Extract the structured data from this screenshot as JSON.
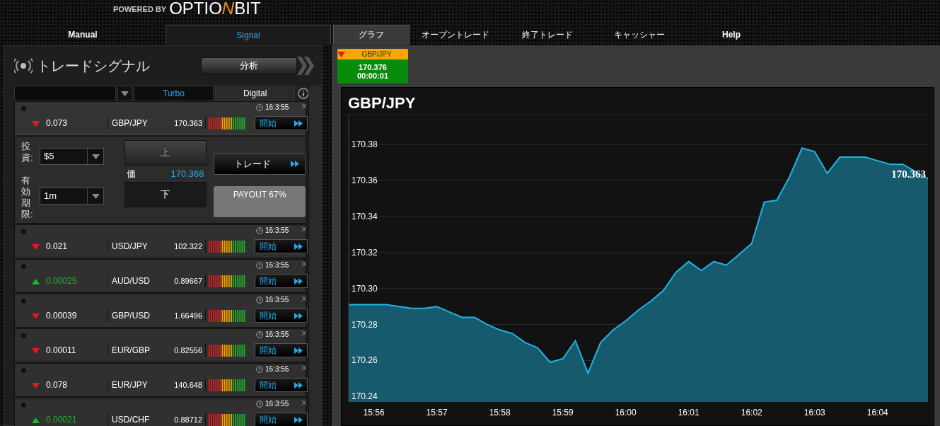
{
  "header": {
    "tagline": "POWERED BY",
    "logo": [
      {
        "text": "OPTIO",
        "accent": false
      },
      {
        "text": "N",
        "accent": true
      },
      {
        "text": "BIT",
        "accent": false
      }
    ]
  },
  "left_tabs": [
    {
      "label": "Manual",
      "selected": false
    },
    {
      "label": "Signal",
      "selected": true
    }
  ],
  "right_tabs": [
    {
      "label": "グラフ",
      "selected": true
    },
    {
      "label": "オープントレード",
      "selected": false
    },
    {
      "label": "終了トレード",
      "selected": false
    },
    {
      "label": "キャッシャー",
      "selected": false
    },
    {
      "label": "Help",
      "selected": false
    }
  ],
  "signals_panel": {
    "title": "トレードシグナル",
    "analyze_button": "分析",
    "filter_tabs": [
      {
        "label": "Turbo",
        "selected": true
      },
      {
        "label": "Digital",
        "selected": false
      }
    ],
    "signals": [
      {
        "rising": false,
        "change": "0.073",
        "pair": "GBP/JPY",
        "price": "170.363",
        "time": "16:3:55",
        "action": "開始",
        "expanded": true
      },
      {
        "rising": false,
        "change": "0.021",
        "pair": "USD/JPY",
        "price": "102.322",
        "time": "16:3:55",
        "action": "開始",
        "expanded": false
      },
      {
        "rising": true,
        "change": "0.00025",
        "pair": "AUD/USD",
        "price": "0.89667",
        "time": "16:3:55",
        "action": "開始",
        "expanded": false
      },
      {
        "rising": false,
        "change": "0.00039",
        "pair": "GBP/USD",
        "price": "1.66496",
        "time": "16:3:55",
        "action": "開始",
        "expanded": false
      },
      {
        "rising": false,
        "change": "0.00011",
        "pair": "EUR/GBP",
        "price": "0.82556",
        "time": "16:3:55",
        "action": "開始",
        "expanded": false
      },
      {
        "rising": false,
        "change": "0.078",
        "pair": "EUR/JPY",
        "price": "140.648",
        "time": "16:3:55",
        "action": "開始",
        "expanded": false
      },
      {
        "rising": true,
        "change": "0.00021",
        "pair": "USD/CHF",
        "price": "0.88712",
        "time": "16:3:55",
        "action": "開始",
        "expanded": false
      }
    ],
    "trade_form": {
      "investment_label": "投資:",
      "investment": "$5",
      "expiry_label": "有効期限:",
      "expiry": "1m",
      "up_button": "上",
      "price_label": "価",
      "price": "170.368",
      "down_button": "下",
      "trade_button": "トレード",
      "payout": "PAYOUT 67%"
    }
  },
  "ticker": {
    "rising": false,
    "pair": "GBP/JPY",
    "price": "170.376",
    "timer": "00:00:01"
  },
  "chart": {
    "title": "GBP/JPY",
    "chart_data": {
      "type": "area",
      "categories": [
        null,
        null,
        "15:56",
        null,
        null,
        null,
        null,
        "15:57",
        null,
        null,
        null,
        null,
        "15:58",
        null,
        null,
        null,
        null,
        "15:59",
        null,
        null,
        null,
        null,
        "16:00",
        null,
        null,
        null,
        null,
        "16:01",
        null,
        null,
        null,
        null,
        "16:02",
        null,
        null,
        null,
        null,
        "16:03",
        null,
        null,
        null,
        null,
        "16:04",
        null,
        null,
        null,
        null
      ],
      "series": [
        {
          "color": "#1fb5e5",
          "values": [
            170.291,
            170.291,
            170.291,
            170.291,
            170.29,
            170.289,
            170.289,
            170.29,
            170.287,
            170.284,
            170.284,
            170.28,
            170.277,
            170.275,
            170.27,
            170.267,
            170.259,
            170.261,
            170.271,
            170.253,
            170.27,
            170.277,
            170.282,
            170.288,
            170.293,
            170.299,
            170.309,
            170.315,
            170.31,
            170.315,
            170.313,
            170.319,
            170.325,
            170.348,
            170.349,
            170.362,
            170.378,
            170.376,
            170.364,
            170.373,
            170.373,
            170.373,
            170.371,
            170.369,
            170.369,
            170.365,
            170.361
          ]
        }
      ],
      "ylim": [
        170.237,
        170.397
      ],
      "yticks": [
        {
          "value": 170.24,
          "label": "170.24"
        },
        {
          "value": 170.26,
          "label": "170.26"
        },
        {
          "value": 170.28,
          "label": "170.28"
        },
        {
          "value": 170.3,
          "label": "170.30"
        },
        {
          "value": 170.32,
          "label": "170.32"
        },
        {
          "value": 170.34,
          "label": "170.34"
        },
        {
          "value": 170.36,
          "label": "170.36"
        },
        {
          "value": 170.38,
          "label": "170.38"
        }
      ],
      "grid": true,
      "annotations": [
        "170.363"
      ]
    }
  }
}
